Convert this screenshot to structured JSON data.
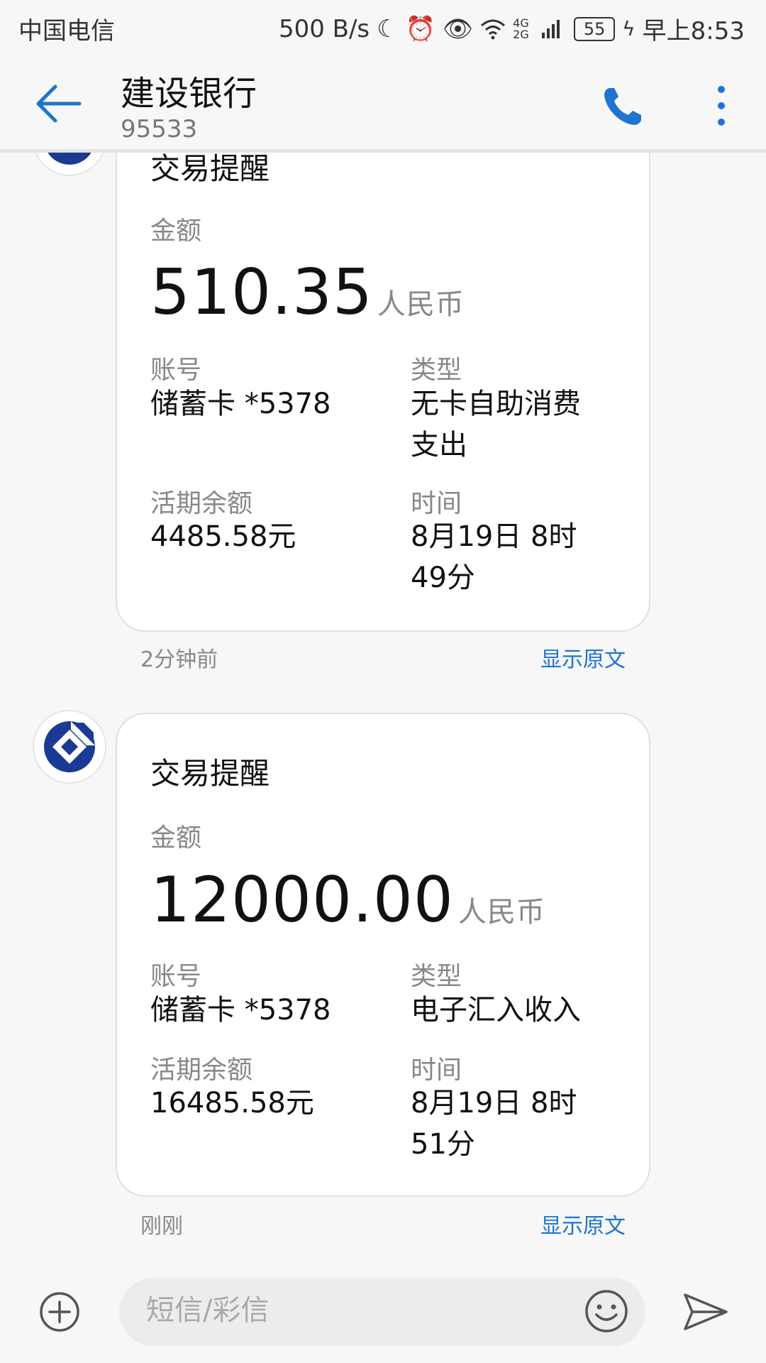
{
  "status_bar": {
    "carrier": "中国电信",
    "net_speed": "500 B/s",
    "network_label": "4G 2G",
    "battery": "55",
    "time": "早上8:53"
  },
  "header": {
    "title": "建设银行",
    "number": "95533"
  },
  "messages": [
    {
      "title": "交易提醒",
      "amount_label": "金额",
      "amount": "510.35",
      "currency": "人民币",
      "account_label": "账号",
      "account": "储蓄卡 *5378",
      "type_label": "类型",
      "type": "无卡自助消费\n支出",
      "balance_label": "活期余额",
      "balance": "4485.58元",
      "time_label": "时间",
      "time": "8月19日 8时\n49分",
      "timestamp": "2分钟前",
      "show_original": "显示原文"
    },
    {
      "title": "交易提醒",
      "amount_label": "金额",
      "amount": "12000.00",
      "currency": "人民币",
      "account_label": "账号",
      "account": "储蓄卡 *5378",
      "type_label": "类型",
      "type": "电子汇入收入",
      "balance_label": "活期余额",
      "balance": "16485.58元",
      "time_label": "时间",
      "time": "8月19日 8时\n51分",
      "timestamp": "刚刚",
      "show_original": "显示原文"
    }
  ],
  "compose": {
    "placeholder": "短信/彩信"
  },
  "colors": {
    "accent": "#1f74d1",
    "bank_logo": "#1b3a93"
  },
  "icons": [
    "back-arrow-icon",
    "phone-icon",
    "more-vertical-icon",
    "bank-logo-icon",
    "plus-circle-icon",
    "emoji-icon",
    "send-icon",
    "moon-icon",
    "alarm-icon",
    "eye-icon",
    "wifi-icon",
    "signal-icon",
    "battery-icon"
  ]
}
